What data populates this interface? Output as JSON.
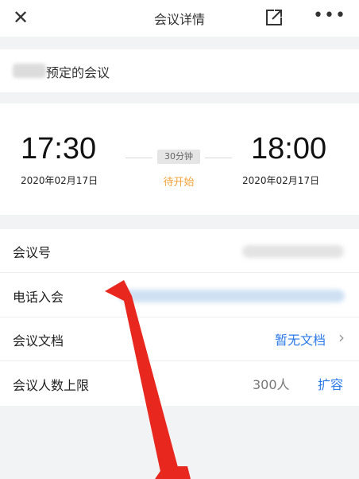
{
  "header": {
    "close_icon": "close-icon",
    "title": "会议详情",
    "share_icon": "external-link-icon",
    "more_icon": "more-dots-icon"
  },
  "organizer": {
    "label": "预定的会议"
  },
  "meeting_time": {
    "start_time": "17:30",
    "start_date": "2020年02月17日",
    "duration": "30分钟",
    "status": "待开始",
    "end_time": "18:00",
    "end_date": "2020年02月17日",
    "status_color": "#f2a33a"
  },
  "details": {
    "meeting_id_label": "会议号",
    "phone_label": "电话入会",
    "docs_label": "会议文档",
    "docs_value": "暂无文档",
    "limit_label": "会议人数上限",
    "limit_value": "300人",
    "expand_label": "扩容",
    "link_color": "#2d7be8"
  },
  "annotation": {
    "arrow_color": "#e8281e"
  }
}
